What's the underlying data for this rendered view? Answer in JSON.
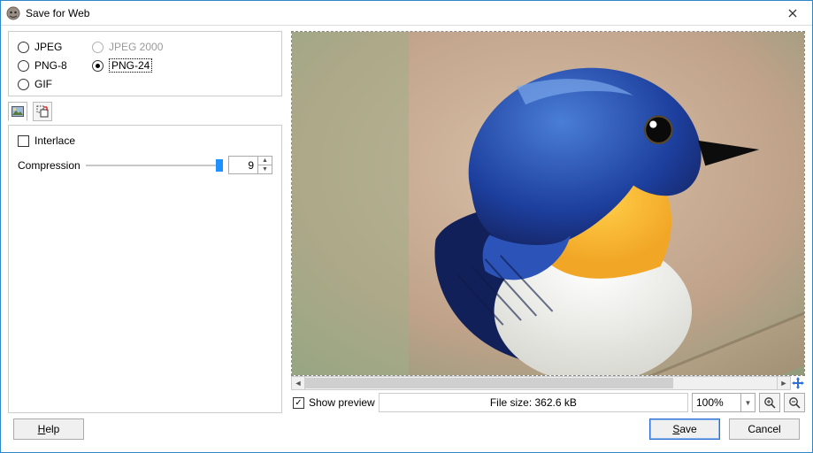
{
  "window": {
    "title": "Save for Web"
  },
  "formats": {
    "jpeg": "JPEG",
    "jpeg2000": "JPEG 2000",
    "png8": "PNG-8",
    "png24": "PNG-24",
    "gif": "GIF",
    "selected": "png24",
    "jpeg2000_enabled": false
  },
  "options": {
    "interlace_label": "Interlace",
    "interlace_checked": false,
    "compression_label": "Compression",
    "compression_value": "9"
  },
  "preview": {
    "show_preview_label": "Show preview",
    "show_preview_checked": true,
    "filesize_label": "File size: 362.6 kB",
    "zoom_value": "100%"
  },
  "buttons": {
    "help": "Help",
    "save": "Save",
    "cancel": "Cancel"
  }
}
